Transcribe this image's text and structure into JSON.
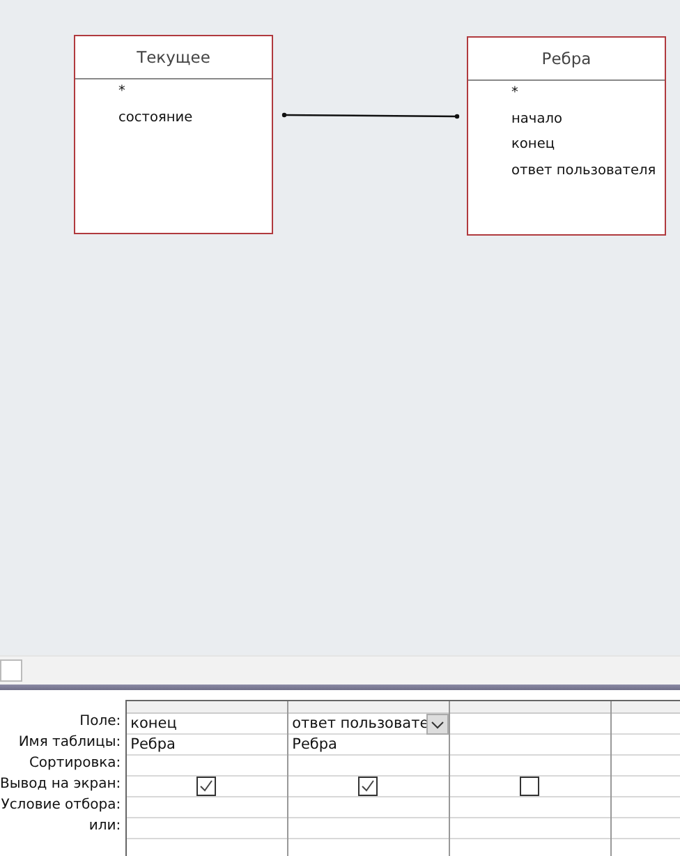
{
  "tables": [
    {
      "name": "Текущее",
      "fields": [
        "*",
        "состояние"
      ]
    },
    {
      "name": "Ребра",
      "fields": [
        "*",
        "начало",
        "конец",
        "ответ пользователя"
      ]
    }
  ],
  "grid": {
    "row_labels": [
      "Поле:",
      "Имя таблицы:",
      "Сортировка:",
      "Вывод на экран:",
      "Условие отбора:",
      "или:"
    ],
    "columns": [
      {
        "field": "конец",
        "table": "Ребра",
        "show": true,
        "dropdown": false
      },
      {
        "field": "ответ пользовате",
        "table": "Ребра",
        "show": true,
        "dropdown": true
      },
      {
        "show": false,
        "dropdown": false
      }
    ]
  }
}
